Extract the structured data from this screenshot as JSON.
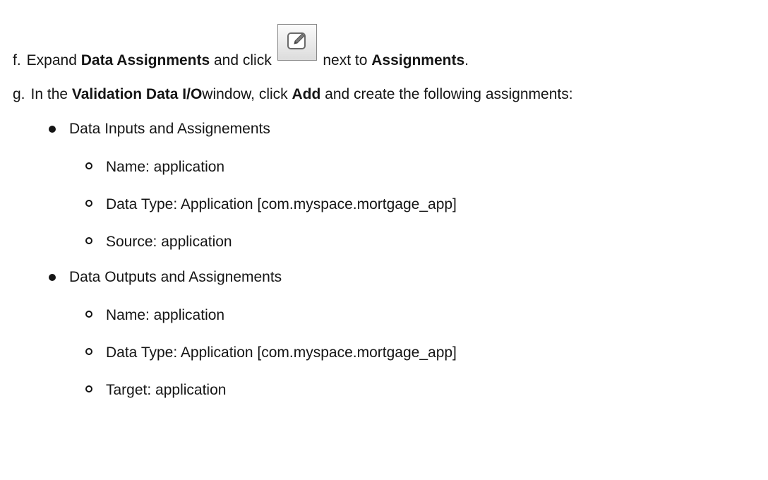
{
  "steps": {
    "f": {
      "marker": "f.",
      "text_1": "Expand ",
      "bold_1": "Data Assignments",
      "text_2": " and click ",
      "text_3": " next to ",
      "bold_2": "Assignments",
      "text_4": "."
    },
    "g": {
      "marker": "g.",
      "text_1": "In the ",
      "bold_1": "Validation Data I/O",
      "text_2": "window, click ",
      "bold_2": "Add",
      "text_3": " and create the following assignments:"
    }
  },
  "inputs": {
    "heading": "Data Inputs and Assignements",
    "items": [
      "Name: application",
      "Data Type: Application [com.myspace.mortgage_app]",
      "Source: application"
    ]
  },
  "outputs": {
    "heading": "Data Outputs and Assignements",
    "items": [
      "Name: application",
      "Data Type: Application [com.myspace.mortgage_app]",
      "Target: application"
    ]
  },
  "icons": {
    "edit_button": "pencil-edit-icon"
  }
}
